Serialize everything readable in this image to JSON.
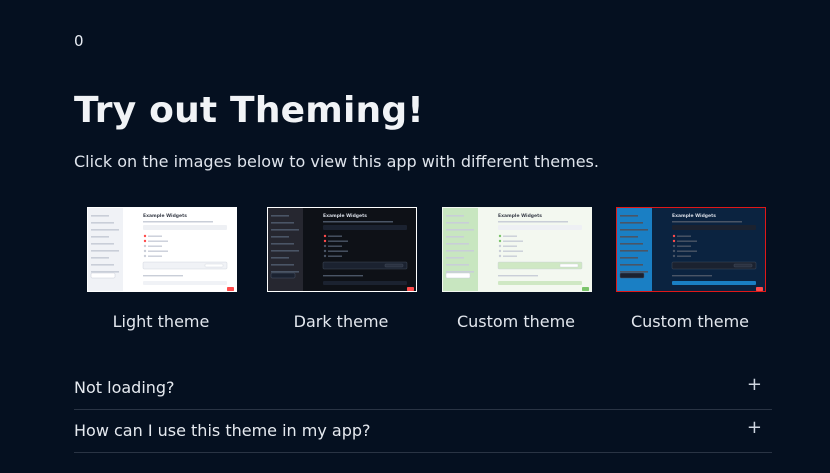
{
  "counter": "0",
  "heading": "Try out Theming!",
  "subheading": "Click on the images below to view this app with different themes.",
  "themes": [
    {
      "label": "Light theme",
      "thumb_title": "Example Widgets",
      "sidebar_color": "#f0f2f6",
      "bg_color": "#ffffff",
      "accent": "#ff4b4b",
      "outline": "#ffffff"
    },
    {
      "label": "Dark theme",
      "thumb_title": "Example Widgets",
      "sidebar_color": "#262730",
      "bg_color": "#0e1117",
      "accent": "#ff4b4b",
      "outline": "#ffffff"
    },
    {
      "label": "Custom theme",
      "thumb_title": "Example Widgets",
      "sidebar_color": "#c8e6c0",
      "bg_color": "#f3f8f0",
      "accent": "#7bc46b",
      "outline": "#f3f8f0"
    },
    {
      "label": "Custom theme",
      "thumb_title": "Example Widgets",
      "sidebar_color": "#1a7fc4",
      "bg_color": "#0b2340",
      "accent": "#ff4b4b",
      "outline": "#e01818"
    }
  ],
  "accordions": [
    {
      "label": "Not loading?",
      "icon": "+"
    },
    {
      "label": "How can I use this theme in my app?",
      "icon": "+"
    }
  ]
}
